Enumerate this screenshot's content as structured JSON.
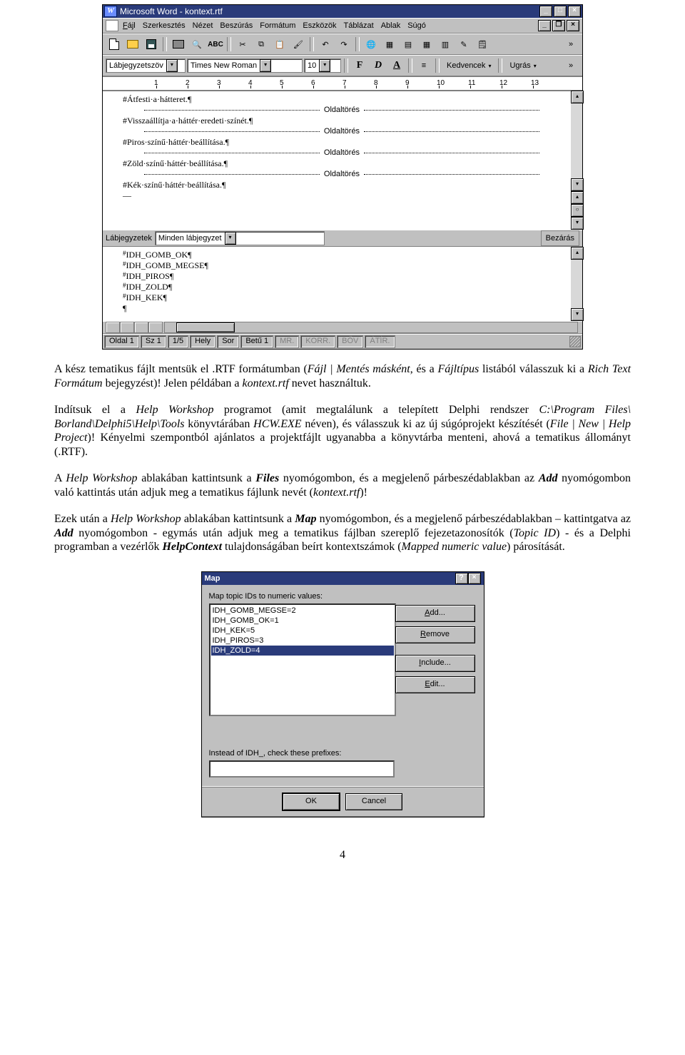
{
  "page_number": "4",
  "fig1": {
    "title": "Microsoft Word - kontext.rtf",
    "app_letter": "W",
    "menus": [
      "Fájl",
      "Szerkesztés",
      "Nézet",
      "Beszúrás",
      "Formátum",
      "Eszközök",
      "Táblázat",
      "Ablak",
      "Súgó"
    ],
    "style_combo": "Lábjegyzetszöv",
    "font_combo": "Times New Roman",
    "size_combo": "10",
    "fav_label": "Kedvencek",
    "jump_label": "Ugrás",
    "bold_letter": "F",
    "italic_letter": "D",
    "underline_letter": "A",
    "ruler_numbers": [
      "1",
      "2",
      "3",
      "4",
      "5",
      "6",
      "7",
      "8",
      "9",
      "10",
      "11",
      "12",
      "13"
    ],
    "doc_lines": [
      "#Átfesti·a·hátteret.¶",
      "#Visszaállítja·a·háttér·eredeti·színét.¶",
      "#Piros·színű·háttér·beállítása.¶",
      "#Zöld·színű·háttér·beállítása.¶",
      "#Kék·színű·háttér·beállítása.¶",
      "—"
    ],
    "pagebreak_label": "Oldaltörés",
    "split_label1": "Lábjegyzetek",
    "split_combo": "Minden lábjegyzet",
    "split_close": "Bezárás",
    "footnotes": [
      "IDH_GOMB_OK¶",
      "IDH_GOMB_MEGSE¶",
      "IDH_PIROS¶",
      "IDH_ZOLD¶",
      "IDH_KEK¶"
    ],
    "status": {
      "page": "Oldal 1",
      "section": "Sz 1",
      "pages": "1/5",
      "at": "Hely",
      "line": "Sor",
      "col": "Betű 1",
      "ind": [
        "MR.",
        "KORR.",
        "BŐV",
        "ÁTÍR."
      ]
    }
  },
  "para1": {
    "t1": "A kész tematikus fájlt mentsük el .RTF formátumban (",
    "i1": "Fájl | Mentés másként",
    "t2": ", és a ",
    "i2": "Fájltípus",
    "t3": " listából válasszuk ki a ",
    "i3": "Rich Text Formátum",
    "t4": " bejegyzést)! Jelen példában a ",
    "i4": "kontext.rtf",
    "t5": " nevet használtuk."
  },
  "para2": {
    "t1": "Indítsuk el a ",
    "i1": "Help Workshop",
    "t2": " programot (amit megtalálunk a telepített Delphi rendszer ",
    "i2": "C:\\Program Files\\ Borland\\Delphi5\\Help\\Tools",
    "t3": " könyvtárában ",
    "i3": "HCW.EXE",
    "t4": " néven), és válasszuk ki az új súgóprojekt készítését (",
    "i4": "File | New | Help Project",
    "t5": ")! Kényelmi szempontból ajánlatos a projektfájlt ugyanabba a könyvtárba menteni, ahová a tematikus állományt (.RTF)."
  },
  "para3": {
    "t1": "A ",
    "i1": "Help Workshop",
    "t2": " ablakában kattintsunk a ",
    "bi1": "Files",
    "t3": " nyomógombon, és a megjelenő párbeszédablakban az ",
    "bi2": "Add",
    "t4": " nyomógombon való kattintás után adjuk meg a tematikus fájlunk nevét (",
    "i2": "kontext.rtf",
    "t5": ")!"
  },
  "para4": {
    "t1": "Ezek után a ",
    "i1": "Help Workshop",
    "t2": " ablakában kattintsunk a ",
    "bi1": "Map",
    "t3": " nyomógombon, és a megjelenő párbeszédablakban – kattintgatva az ",
    "bi2": "Add",
    "t4": " nyomógombon - egymás után adjuk meg a tematikus fájlban szereplő fejezetazonosítók (",
    "i2": "Topic ID",
    "t5": ") - és a Delphi programban a vezérlők ",
    "bi3": "HelpContext",
    "t6": " tulajdonságában beírt kontextszámok (",
    "i3": "Mapped numeric value",
    "t7": ") párosítását."
  },
  "fig2": {
    "title": "Map",
    "label1": "Map topic IDs to numeric values:",
    "list": [
      "IDH_GOMB_MEGSE=2",
      "IDH_GOMB_OK=1",
      "IDH_KEK=5",
      "IDH_PIROS=3",
      "IDH_ZOLD=4"
    ],
    "selected_index": 4,
    "btns": [
      "Add...",
      "Remove",
      "Include...",
      "Edit..."
    ],
    "label2": "Instead of IDH_, check these prefixes:",
    "ok": "OK",
    "cancel": "Cancel"
  }
}
